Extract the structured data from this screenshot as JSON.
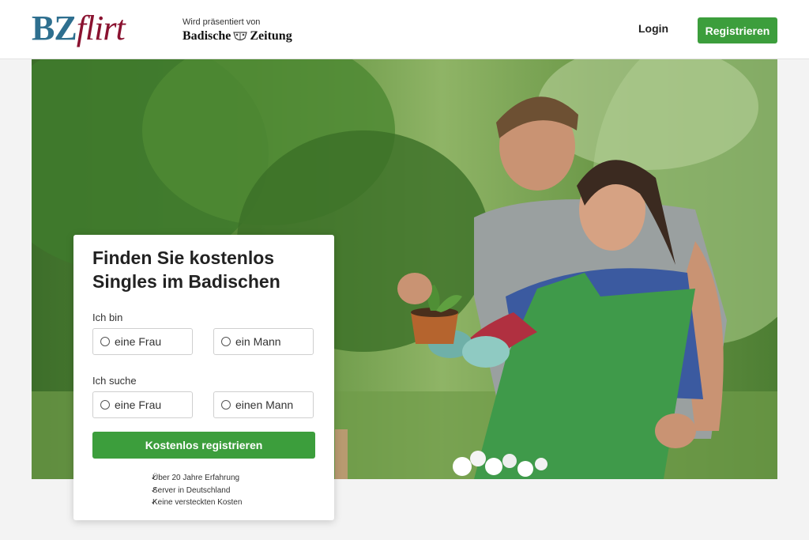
{
  "header": {
    "logo_bz": "BZ",
    "logo_flirt": "flirt",
    "presented_by": "Wird präsentiert von",
    "paper_left": "Badische",
    "paper_right": "Zeitung",
    "login_label": "Login",
    "register_label": "Registrieren"
  },
  "form": {
    "title": "Finden Sie kostenlos Singles im Badischen",
    "i_am_label": "Ich bin",
    "i_am_options": [
      "eine Frau",
      "ein Mann"
    ],
    "seeking_label": "Ich suche",
    "seeking_options": [
      "eine Frau",
      "einen Mann"
    ],
    "cta_label": "Kostenlos registrieren",
    "benefits": [
      "Über 20 Jahre Erfahrung",
      "Server in Deutschland",
      "Keine versteckten Kosten"
    ]
  },
  "icons": {
    "check": "check-icon",
    "radio": "radio-icon",
    "crest": "crest-icon"
  },
  "colors": {
    "accent_green": "#3c9e3c",
    "logo_blue": "#2e6f8f",
    "logo_red": "#8a1230"
  }
}
